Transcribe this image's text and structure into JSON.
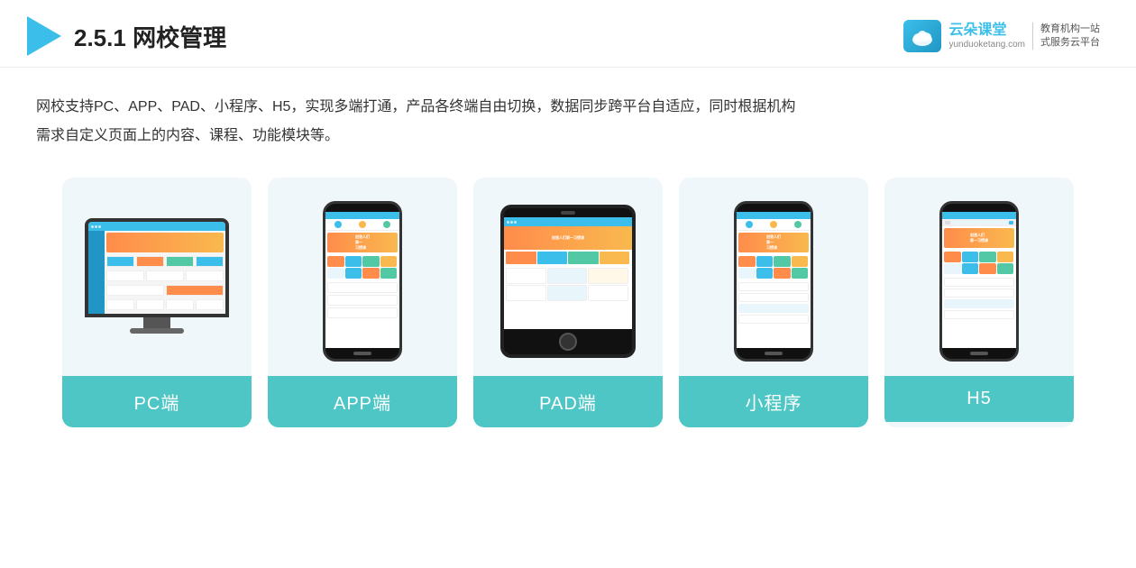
{
  "header": {
    "section_number": "2.5.1",
    "title": "网校管理",
    "brand": {
      "name": "云朵课堂",
      "url": "yunduoketang.com",
      "slogan_line1": "教育机构一站",
      "slogan_line2": "式服务云平台"
    }
  },
  "description": {
    "text_line1": "网校支持PC、APP、PAD、小程序、H5，实现多端打通，产品各终端自由切换，数据同步跨平台自适应，同时根据机构",
    "text_line2": "需求自定义页面上的内容、课程、功能模块等。"
  },
  "cards": [
    {
      "id": "pc",
      "label": "PC端"
    },
    {
      "id": "app",
      "label": "APP端"
    },
    {
      "id": "pad",
      "label": "PAD端"
    },
    {
      "id": "miniprogram",
      "label": "小程序"
    },
    {
      "id": "h5",
      "label": "H5"
    }
  ],
  "colors": {
    "accent": "#3bbfea",
    "card_bg": "#eef6fa",
    "card_label_bg": "#4ec6c6",
    "orange": "#ff8c4b",
    "yellow": "#f9b94e"
  }
}
